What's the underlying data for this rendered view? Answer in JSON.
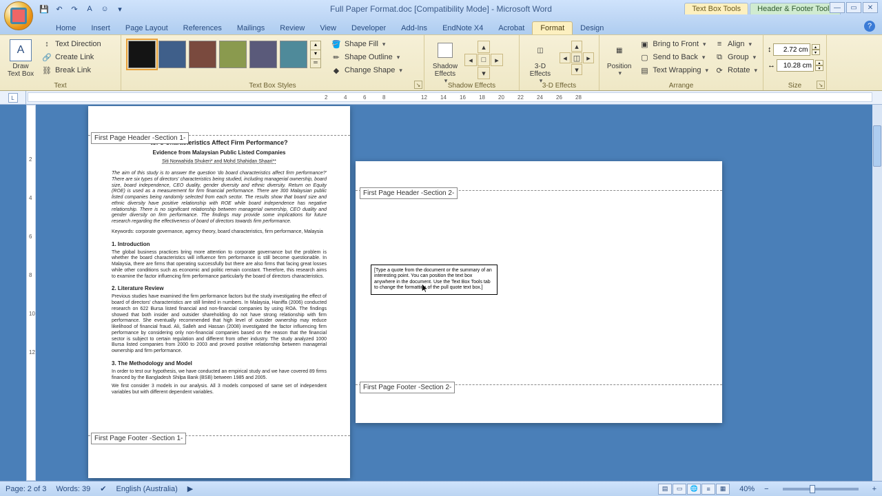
{
  "title": "Full Paper Format.doc [Compatibility Mode] - Microsoft Word",
  "context_tabs": {
    "textbox": "Text Box Tools",
    "header_footer": "Header & Footer Tools"
  },
  "tabs": [
    "Home",
    "Insert",
    "Page Layout",
    "References",
    "Mailings",
    "Review",
    "View",
    "Developer",
    "Add-Ins",
    "EndNote X4",
    "Acrobat",
    "Format",
    "Design"
  ],
  "active_tab": "Format",
  "ribbon": {
    "text": {
      "label": "Text",
      "draw": "Draw\nText Box",
      "items": [
        "Text Direction",
        "Create Link",
        "Break Link"
      ]
    },
    "styles": {
      "label": "Text Box Styles",
      "shape_fill": "Shape Fill",
      "shape_outline": "Shape Outline",
      "change_shape": "Change Shape",
      "colors": [
        "#141414",
        "#3f5f8a",
        "#7a4a3e",
        "#8a9a4e",
        "#5a5a7a",
        "#4f8a9a"
      ]
    },
    "shadow": {
      "label": "Shadow Effects",
      "btn": "Shadow\nEffects"
    },
    "threed": {
      "label": "3-D Effects",
      "btn": "3-D\nEffects"
    },
    "arrange": {
      "label": "Arrange",
      "position": "Position",
      "bring": "Bring to Front",
      "send": "Send to Back",
      "wrap": "Text Wrapping",
      "align": "Align",
      "group": "Group",
      "rotate": "Rotate"
    },
    "size": {
      "label": "Size",
      "h": "2.72 cm",
      "w": "10.28 cm"
    }
  },
  "ruler_ticks": [
    "2",
    "4",
    "6",
    "8",
    "12",
    "14",
    "16",
    "18",
    "20",
    "22",
    "24",
    "26",
    "28"
  ],
  "vruler": [
    "2",
    "4",
    "6",
    "8",
    "10",
    "12"
  ],
  "page1": {
    "header_tag": "First Page Header -Section 1-",
    "footer_tag": "First Page Footer -Section 1-",
    "title1": "tor's Characteristics Affect Firm Performance?",
    "title2": "Evidence from Malaysian Public Listed Companies",
    "authors": "Siti Norwahida Shukeri* and Mohd Shahidan Shaari**",
    "abstract": "The aim of this study is to answer the question 'do board characteristics affect firm performance?' There are six types of directors' characteristics being studied, including managerial ownership, board size, board independence, CEO duality, gender diversity and ethnic diversity. Return on Equity (ROE) is used as a measurement for firm financial performance. There are 300 Malaysian public listed companies being randomly selected from each sector. The results show that board size and ethnic diversity have positive relationship with ROE while board independence has negative relationship. There is no significant relationship between managerial ownership, CEO duality and gender diversity on firm performance. The findings may provide some implications for future research regarding the effectiveness of board of directors towards firm performance.",
    "keywords": "Keywords: corporate governance, agency theory, board characteristics, firm performance, Malaysia",
    "s1": "1. Introduction",
    "p1": "The global business practices bring more attention to corporate governance but the problem is whether the board characteristics will influence firm performance is still become questionable. In Malaysia, there are firms that operating successfully but there are also firms that facing great losses while other conditions such as economic and politic remain constant. Therefore, this research aims to examine the factor influencing firm performance particularly the board of directors characteristics.",
    "s2": "2. Literature Review",
    "p2": "Previous studies have examined the firm performance factors but the study investigating the effect of board of directors' characteristics are still limited in numbers. In Malaysia, Haniffa (2006) conducted research on 622 Bursa listed financial and non-financial companies by using ROA. The findings showed that both insider and outsider shareholding do not have strong relationship with firm performance. She eventually recommended that high level of outsider ownership may reduce likelihood of financial fraud. Ali, Salleh and Hassan (2008) investigated the factor influencing firm performance by considering only non-financial companies based on the reason that the financial sector is subject to certain regulation and different from other industry. The study analyzed 1000 Bursa listed companies from 2000 to 2003 and proved positive relationship between managerial ownership and firm performance.",
    "s3": "3. The Methodology and Model",
    "p3": "In order to test our hypothesis, we have conducted an empirical study and we have covered 89 firms financed by the Bangladesh Shilpa Bank (BSB) between 1985 and 2005.",
    "p4": "We first consider 3 models in our analysis. All 3 models composed of same set of independent variables but with different dependent variables."
  },
  "page2": {
    "header_tag": "First Page Header -Section 2-",
    "footer_tag": "First Page Footer -Section 2-",
    "quote": "[Type a quote from the document or the summary of an interesting point. You can position the text box anywhere in the document. Use the Text Box Tools tab to change the formatting of the pull quote text box.]"
  },
  "status": {
    "page": "Page: 2 of 3",
    "words": "Words: 39",
    "lang": "English (Australia)",
    "zoom": "40%"
  }
}
